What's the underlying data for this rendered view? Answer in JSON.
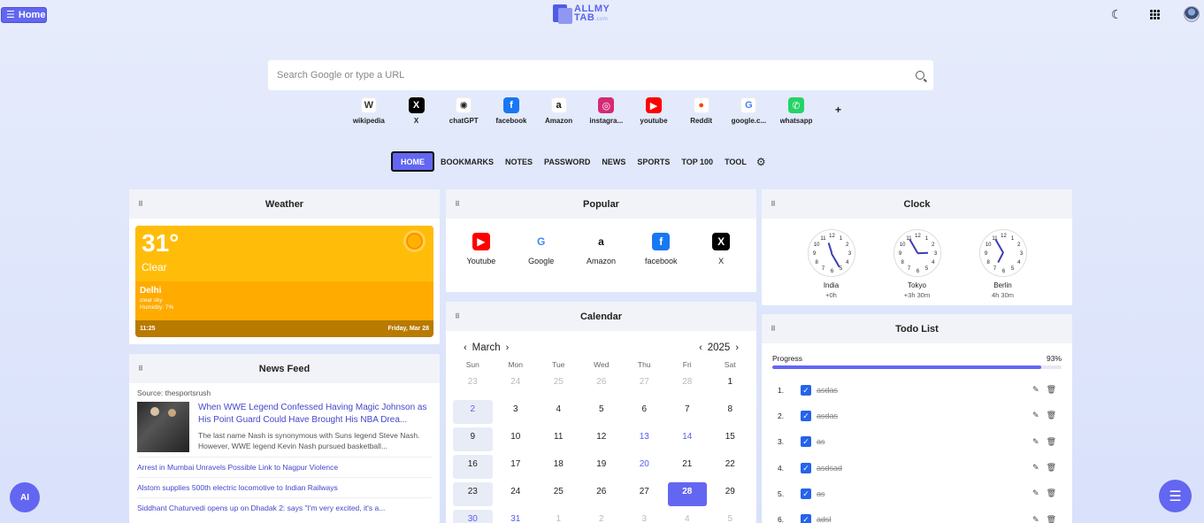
{
  "header": {
    "home_label": "Home",
    "logo_line1": "ALLMY",
    "logo_line2": "TAB",
    "logo_suffix": ".com"
  },
  "search": {
    "placeholder": "Search Google or type a URL"
  },
  "shortcuts": [
    {
      "label": "wikipedia",
      "glyph": "W",
      "color": "#ffffff",
      "fg": "#333333"
    },
    {
      "label": "X",
      "glyph": "X",
      "color": "#000000",
      "fg": "#ffffff"
    },
    {
      "label": "chatGPT",
      "glyph": "✺",
      "color": "#ffffff",
      "fg": "#222222"
    },
    {
      "label": "facebook",
      "glyph": "f",
      "color": "#1877f2",
      "fg": "#ffffff"
    },
    {
      "label": "Amazon",
      "glyph": "a",
      "color": "#ffffff",
      "fg": "#111111"
    },
    {
      "label": "instagra...",
      "glyph": "◎",
      "color": "#d62976",
      "fg": "#ffffff"
    },
    {
      "label": "youtube",
      "glyph": "▶",
      "color": "#ff0000",
      "fg": "#ffffff"
    },
    {
      "label": "Reddit",
      "glyph": "●",
      "color": "#ffffff",
      "fg": "#ff4500"
    },
    {
      "label": "google.c...",
      "glyph": "G",
      "color": "#ffffff",
      "fg": "#4285f4"
    },
    {
      "label": "whatsapp",
      "glyph": "✆",
      "color": "#25d366",
      "fg": "#ffffff"
    }
  ],
  "add_label": "+",
  "tabs": [
    "HOME",
    "BOOKMARKS",
    "NOTES",
    "PASSWORD",
    "NEWS",
    "SPORTS",
    "TOP 100",
    "TOOL"
  ],
  "weather": {
    "title": "Weather",
    "temp": "31°",
    "condition": "Clear",
    "city": "Delhi",
    "detail1": "clear sky",
    "detail2": "Humidity: 7%",
    "time": "11:25",
    "date": "Friday, Mar 28"
  },
  "popular": {
    "title": "Popular",
    "items": [
      {
        "label": "Youtube",
        "glyph": "▶",
        "color": "#ff0000",
        "fg": "#ffffff"
      },
      {
        "label": "Google",
        "glyph": "G",
        "color": "#ffffff",
        "fg": "#4285f4"
      },
      {
        "label": "Amazon",
        "glyph": "a",
        "color": "#ffffff",
        "fg": "#111111"
      },
      {
        "label": "facebook",
        "glyph": "f",
        "color": "#1877f2",
        "fg": "#ffffff"
      },
      {
        "label": "X",
        "glyph": "X",
        "color": "#000000",
        "fg": "#ffffff"
      }
    ]
  },
  "calendar": {
    "title": "Calendar",
    "month": "March",
    "year": "2025",
    "dow": [
      "Sun",
      "Mon",
      "Tue",
      "Wed",
      "Thu",
      "Fri",
      "Sat"
    ],
    "days": [
      {
        "d": "23",
        "t": "out"
      },
      {
        "d": "24",
        "t": "out"
      },
      {
        "d": "25",
        "t": "out"
      },
      {
        "d": "26",
        "t": "out"
      },
      {
        "d": "27",
        "t": "out"
      },
      {
        "d": "28",
        "t": "out"
      },
      {
        "d": "1",
        "t": ""
      },
      {
        "d": "2",
        "t": "sun blue"
      },
      {
        "d": "3",
        "t": ""
      },
      {
        "d": "4",
        "t": ""
      },
      {
        "d": "5",
        "t": ""
      },
      {
        "d": "6",
        "t": ""
      },
      {
        "d": "7",
        "t": ""
      },
      {
        "d": "8",
        "t": ""
      },
      {
        "d": "9",
        "t": "sun"
      },
      {
        "d": "10",
        "t": ""
      },
      {
        "d": "11",
        "t": ""
      },
      {
        "d": "12",
        "t": ""
      },
      {
        "d": "13",
        "t": "blue"
      },
      {
        "d": "14",
        "t": "blue"
      },
      {
        "d": "15",
        "t": ""
      },
      {
        "d": "16",
        "t": "sun"
      },
      {
        "d": "17",
        "t": ""
      },
      {
        "d": "18",
        "t": ""
      },
      {
        "d": "19",
        "t": ""
      },
      {
        "d": "20",
        "t": "blue"
      },
      {
        "d": "21",
        "t": ""
      },
      {
        "d": "22",
        "t": ""
      },
      {
        "d": "23",
        "t": "sun"
      },
      {
        "d": "24",
        "t": ""
      },
      {
        "d": "25",
        "t": ""
      },
      {
        "d": "26",
        "t": ""
      },
      {
        "d": "27",
        "t": ""
      },
      {
        "d": "28",
        "t": "today"
      },
      {
        "d": "29",
        "t": ""
      },
      {
        "d": "30",
        "t": "sun blue"
      },
      {
        "d": "31",
        "t": "blue"
      },
      {
        "d": "1",
        "t": "out"
      },
      {
        "d": "2",
        "t": "out"
      },
      {
        "d": "3",
        "t": "out"
      },
      {
        "d": "4",
        "t": "out"
      },
      {
        "d": "5",
        "t": "out"
      }
    ]
  },
  "clock": {
    "title": "Clock",
    "clocks": [
      {
        "city": "India",
        "offset": "+0h",
        "h": 11,
        "m": 25
      },
      {
        "city": "Tokyo",
        "offset": "+3h 30m",
        "h": 2,
        "m": 55
      },
      {
        "city": "Berlin",
        "offset": "4h 30m",
        "h": 6,
        "m": 55
      }
    ]
  },
  "todo": {
    "title": "Todo List",
    "progress_label": "Progress",
    "progress_value": "93%",
    "progress": 0.93,
    "items": [
      {
        "num": "1.",
        "text": "asdas"
      },
      {
        "num": "2.",
        "text": "asdas"
      },
      {
        "num": "3.",
        "text": "as"
      },
      {
        "num": "4.",
        "text": "asdsad"
      },
      {
        "num": "5.",
        "text": "as"
      },
      {
        "num": "6.",
        "text": "adsl"
      }
    ]
  },
  "news": {
    "title": "News Feed",
    "source": "Source: thesportsrush",
    "main_title": "When WWE Legend Confessed Having Magic Johnson as His Point Guard Could Have Brought His NBA Drea...",
    "main_desc": "The last name Nash is synonymous with Suns legend Steve Nash. However, WWE legend Kevin Nash pursued basketball...",
    "links": [
      "Arrest in Mumbai Unravels Possible Link to Nagpur Violence",
      "Alstom supplies 500th electric locomotive to Indian Railways",
      "Siddhant Chaturvedi opens up on Dhadak 2: says \"I'm very excited, it's a..."
    ]
  },
  "fab": {
    "ai_label": "AI"
  }
}
